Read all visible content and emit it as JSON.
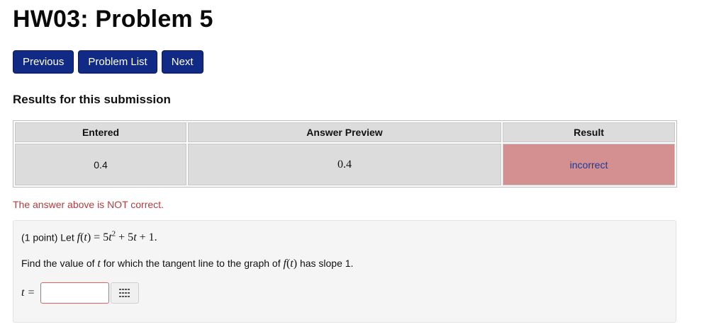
{
  "page": {
    "title": "HW03: Problem 5"
  },
  "nav": {
    "previous_label": "Previous",
    "problem_list_label": "Problem List",
    "next_label": "Next"
  },
  "results": {
    "heading": "Results for this submission",
    "columns": [
      "Entered",
      "Answer Preview",
      "Result"
    ],
    "row": {
      "entered": "0.4",
      "preview": "0.4",
      "result": "incorrect"
    },
    "feedback": "The answer above is NOT correct."
  },
  "problem": {
    "points": "(1 point)",
    "let_text": "Let",
    "question_prefix": "Find the value of",
    "question_mid": "for which the tangent line to the graph of",
    "question_suffix": "has slope 1.",
    "answer_label": "t =",
    "answer_value": "",
    "palette_icon": "equation-editor-grid-icon"
  },
  "colors": {
    "button_bg": "#102a85",
    "incorrect_bg": "#d49090",
    "feedback_text": "#b83b3b",
    "incorrect_text": "#1a3a9a"
  }
}
